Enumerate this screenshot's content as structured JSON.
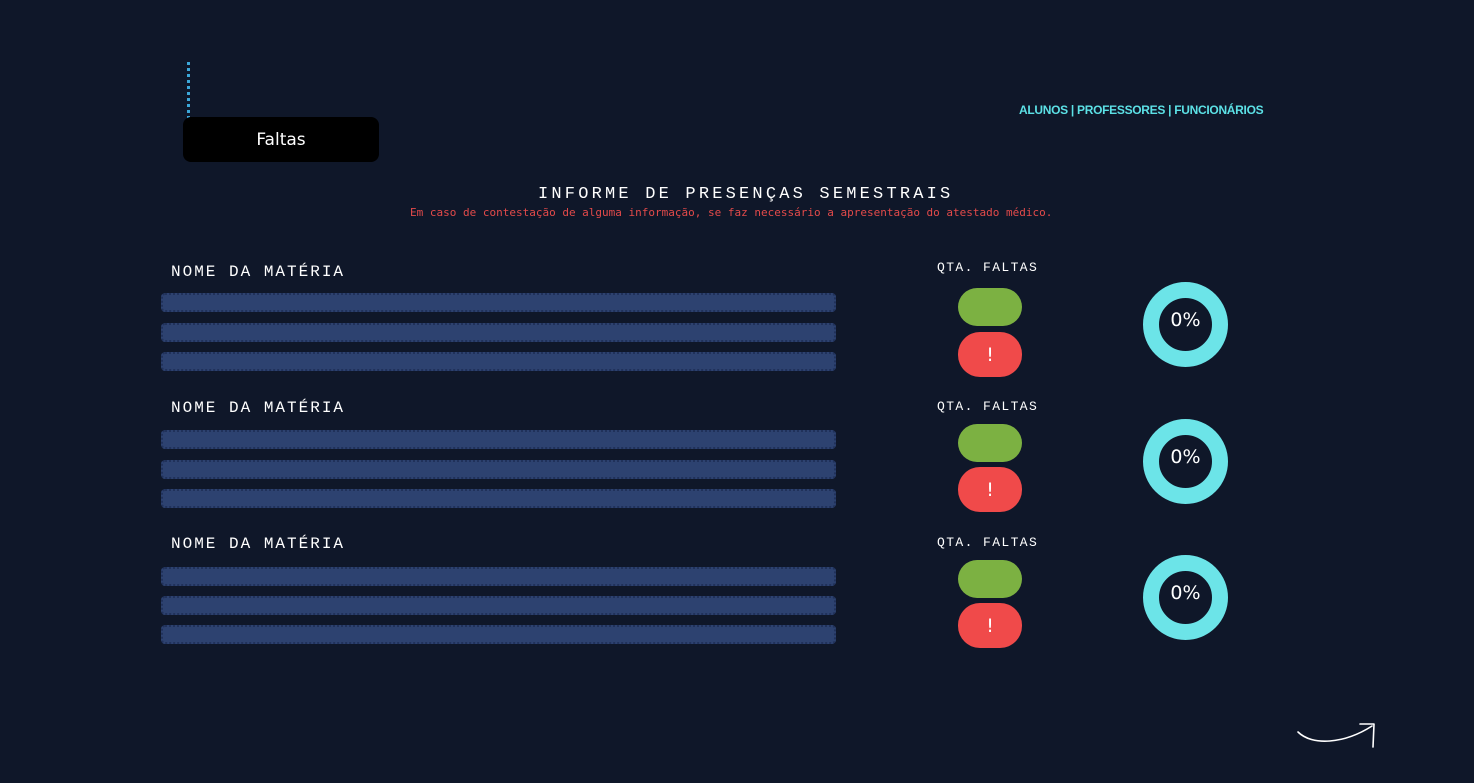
{
  "tab": {
    "label": "Faltas"
  },
  "nav": {
    "alunos": "ALUNOS",
    "professores": "PROFESSORES",
    "funcionarios": "FUNCIONÁRIOS",
    "separator": "|"
  },
  "header": {
    "title": "INFORME DE PRESENÇAS SEMESTRAIS",
    "notice": "Em caso de contestação de alguma informação, se faz necessário a apresentação do atestado médico."
  },
  "subjects": [
    {
      "name_label": "NOME DA MATÉRIA",
      "absences_label": "QTA. FALTAS",
      "alert": "!",
      "percent": "0%"
    },
    {
      "name_label": "NOME DA MATÉRIA",
      "absences_label": "QTA. FALTAS",
      "alert": "!",
      "percent": "0%"
    },
    {
      "name_label": "NOME DA MATÉRIA",
      "absences_label": "QTA. FALTAS",
      "alert": "!",
      "percent": "0%"
    }
  ],
  "icons": {
    "next": "curved-arrow-right-icon"
  },
  "colors": {
    "background": "#0f1729",
    "accent": "#5ce1e6",
    "notice": "#e34a4a",
    "bar": "#2d4270",
    "ok": "#7cb142",
    "alert": "#f04a4a",
    "ring": "#6ce4e8"
  }
}
